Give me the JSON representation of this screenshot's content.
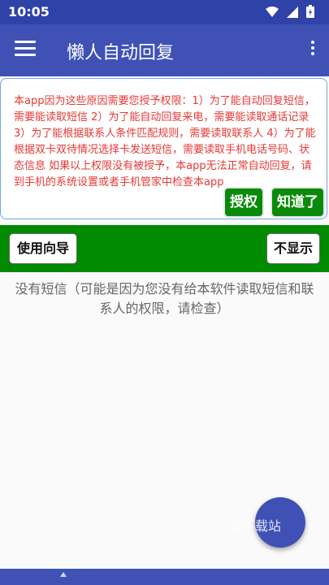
{
  "status_bar": {
    "time": "10:05",
    "icons": [
      "wifi-icon",
      "signal-icon",
      "battery-icon"
    ]
  },
  "app_bar": {
    "title": "懒人自动回复",
    "menu_icon": "hamburger-menu-icon",
    "more_icon": "more-vert-icon",
    "background": "#3f51b5"
  },
  "notice": {
    "text": "本app因为这些原因需要您授予权限：1）为了能自动回复短信，需要能读取短信 2）为了能自动回复来电，需要能读取通话记录 3）为了能根据联系人条件匹配规则，需要读取联系人 4）为了能根据双卡双待情况选择卡发送短信，需要读取手机电话号码、状态信息 如果以上权限没有被授予，本app无法正常自动回复，请到手机的系统设置或者手机管家中检查本app",
    "grant_label": "授权",
    "ok_label": "知道了",
    "text_color": "#e53935"
  },
  "guide_bar": {
    "guide_label": "使用向导",
    "hide_label": "不显示",
    "background": "#008a00"
  },
  "empty_message": "没有短信（可能是因为您没有给本软件读取短信和联系人的权限，请检查）",
  "watermark": "当下载站",
  "colors": {
    "primary": "#3f51b5",
    "status_bar": "#2f42a8",
    "accent_green": "#008a00"
  }
}
